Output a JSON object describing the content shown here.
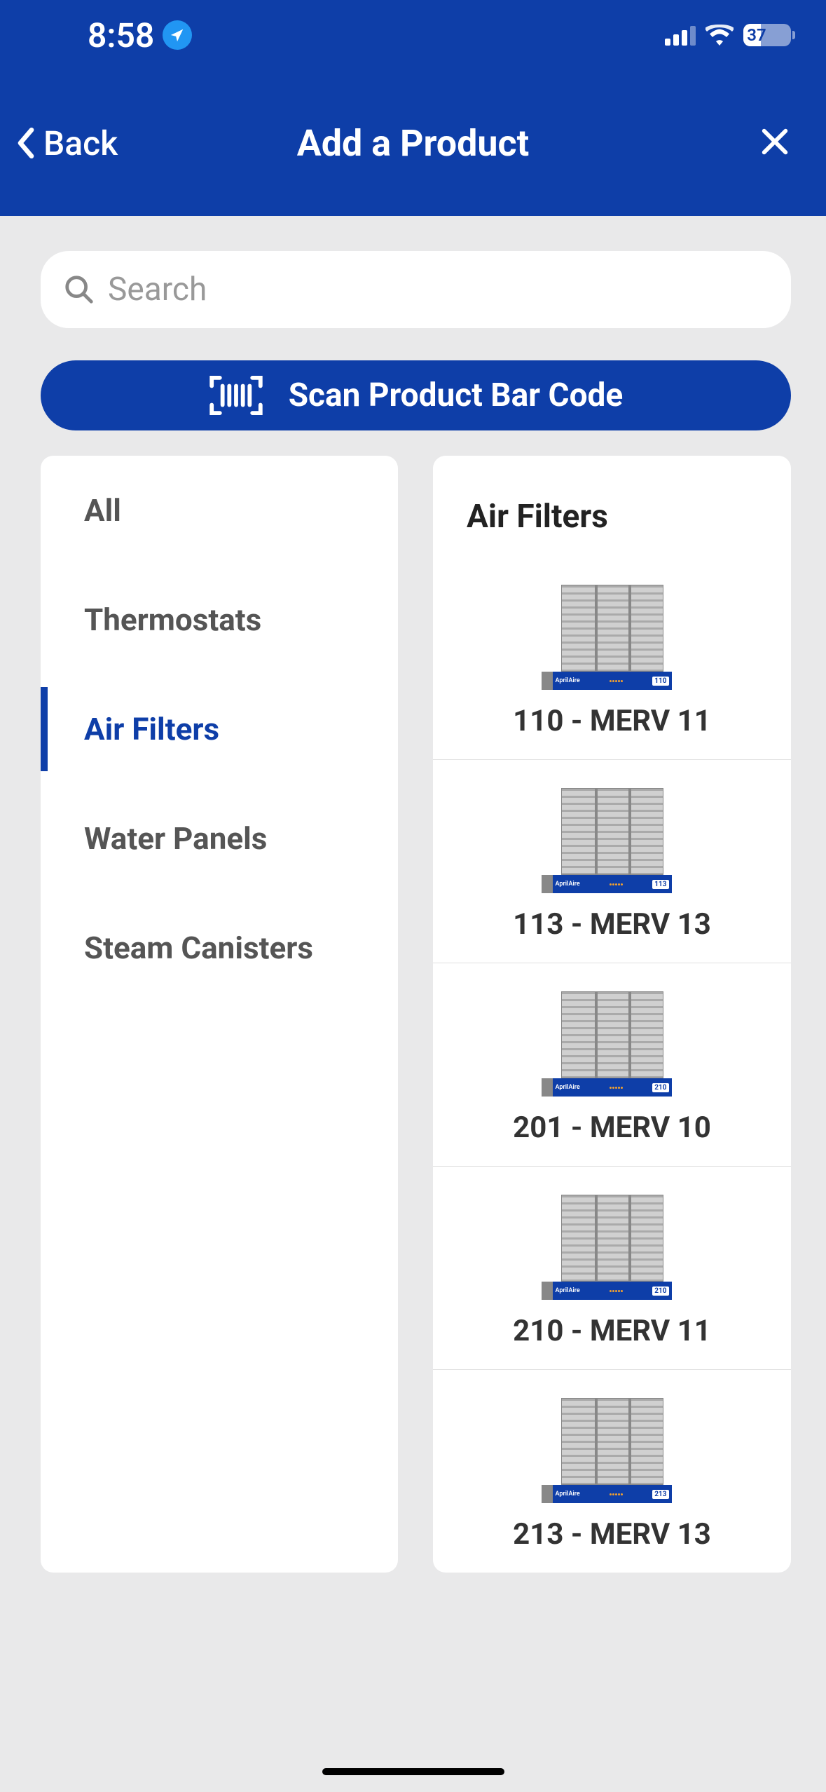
{
  "statusBar": {
    "time": "8:58",
    "battery": "37"
  },
  "nav": {
    "back": "Back",
    "title": "Add a Product"
  },
  "search": {
    "placeholder": "Search"
  },
  "scanButton": "Scan Product Bar Code",
  "categories": [
    {
      "label": "All",
      "selected": false
    },
    {
      "label": "Thermostats",
      "selected": false
    },
    {
      "label": "Air Filters",
      "selected": true
    },
    {
      "label": "Water Panels",
      "selected": false
    },
    {
      "label": "Steam Canisters",
      "selected": false
    }
  ],
  "productPanel": {
    "title": "Air Filters",
    "brand": "AprilAire"
  },
  "products": [
    {
      "name": "110 - MERV 11",
      "boxNum": "110"
    },
    {
      "name": "113 - MERV 13",
      "boxNum": "113"
    },
    {
      "name": "201 - MERV 10",
      "boxNum": "210"
    },
    {
      "name": "210 - MERV 11",
      "boxNum": "210"
    },
    {
      "name": "213 - MERV 13",
      "boxNum": "213"
    }
  ]
}
